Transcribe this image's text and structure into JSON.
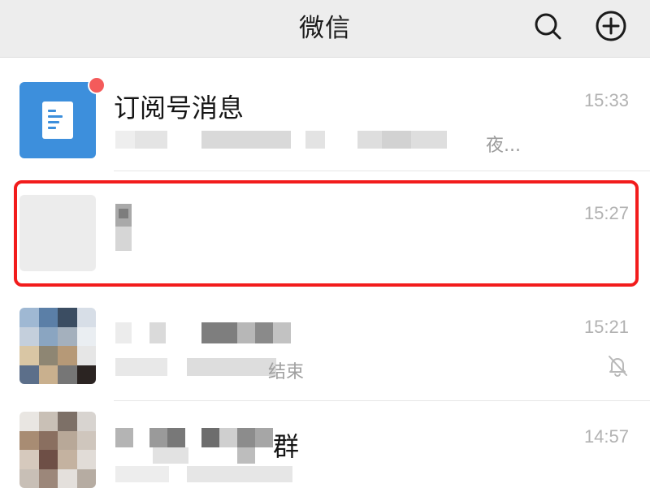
{
  "header": {
    "title": "微信",
    "icons": [
      "search-icon",
      "plus-circle-icon"
    ]
  },
  "chats": [
    {
      "name": "订阅号消息",
      "time": "15:33",
      "preview_visible": "夜...",
      "has_unread_badge": true,
      "avatar": "subscription-document-icon"
    },
    {
      "name": "",
      "time": "15:27",
      "highlighted": true
    },
    {
      "name": "",
      "time": "15:21",
      "preview_visible": "结束",
      "muted": true
    },
    {
      "name_visible": "群",
      "time": "14:57"
    }
  ],
  "colors": {
    "header_bg": "#ededed",
    "badge": "#f45b5b",
    "highlight_border": "#f21c1c",
    "subscription_avatar": "#3d8fdc",
    "time_text": "#b2b2b2"
  }
}
